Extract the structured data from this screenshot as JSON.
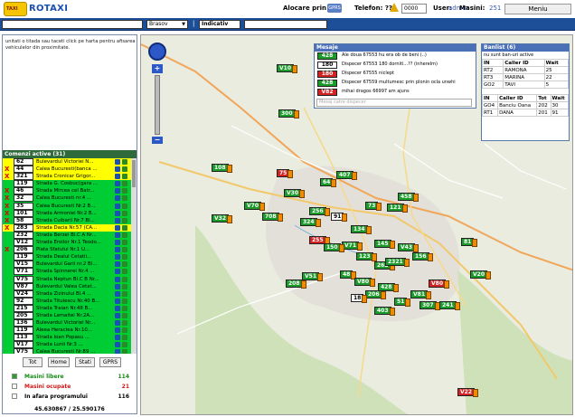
{
  "header": {
    "app_title": "ROTAXI",
    "alocare_label": "Alocare prin",
    "gprs_badge": "GPRS",
    "telefon_label": "Telefon: ???",
    "code_value": "0000",
    "user_label": "User:",
    "user_name": "admin",
    "masini_label": "Masini:",
    "masini_count": "251",
    "menu_button": "Meniu"
  },
  "toolbar": {
    "city": "Brasov",
    "separator": "|",
    "indicativ": "Indicativ"
  },
  "left": {
    "info_text": "unitati o titada sau taceti click pe harta pentru afisarea vehiculelor din proximitate.",
    "commands_header": "Comenzi active (31)",
    "rows": [
      {
        "x": "",
        "code": "62",
        "addr": "Bulevardul Victoriei N...",
        "bg": "#ffff00"
      },
      {
        "x": "X",
        "code": "44",
        "addr": "Calea Bucuresti(banca ...",
        "bg": "#ffff00"
      },
      {
        "x": "X",
        "code": "321",
        "addr": "Strada Cronicar Grigor...",
        "bg": "#ffff00"
      },
      {
        "x": "",
        "code": "119",
        "addr": "Strada G. Cosbuc(gara ...",
        "bg": "#00cc33"
      },
      {
        "x": "X",
        "code": "46",
        "addr": "Strada Mircea cel Batr...",
        "bg": "#00cc33"
      },
      {
        "x": "X",
        "code": "32",
        "addr": "Calea Bucuresti nr.4 ...",
        "bg": "#00cc33"
      },
      {
        "x": "X",
        "code": "35",
        "addr": "Calea Bucuresti Nr.2 B...",
        "bg": "#00cc33"
      },
      {
        "x": "X",
        "code": "101",
        "addr": "Strada Armoniei Nr.2 B...",
        "bg": "#00cc33"
      },
      {
        "x": "X",
        "code": "58",
        "addr": "Strada Cuibaril Nr.7 Bl...",
        "bg": "#00cc33"
      },
      {
        "x": "X",
        "code": "283",
        "addr": "Strada Dacia Nr.57 (CA...",
        "bg": "#ffff00"
      },
      {
        "x": "",
        "code": "232",
        "addr": "Strada Berzei Bl.C A Nr...",
        "bg": "#00cc33"
      },
      {
        "x": "",
        "code": "V12",
        "addr": "Strada Eroilor Nr.1 Teodo...",
        "bg": "#00cc33"
      },
      {
        "x": "X",
        "code": "206",
        "addr": "Piata Sfatului Nr.1 U...",
        "bg": "#00cc33"
      },
      {
        "x": "",
        "code": "119",
        "addr": "Strada Dealul Cetatii...",
        "bg": "#00cc33"
      },
      {
        "x": "",
        "code": "V15",
        "addr": "Bulevardul Garii nr.2 Bl...",
        "bg": "#00cc33"
      },
      {
        "x": "",
        "code": "V71",
        "addr": "Strada Spinnerei Nr.4 ...",
        "bg": "#00cc33"
      },
      {
        "x": "",
        "code": "V75",
        "addr": "Strada Neptun Bl.C B Nr...",
        "bg": "#00cc33"
      },
      {
        "x": "",
        "code": "V87",
        "addr": "Bulevardul Valea Cetat...",
        "bg": "#00cc33"
      },
      {
        "x": "",
        "code": "V24",
        "addr": "Strada Zizinului Bl.4 ...",
        "bg": "#00cc33"
      },
      {
        "x": "",
        "code": "92",
        "addr": "Strada Titulescu Nr.40 B...",
        "bg": "#00cc33"
      },
      {
        "x": "",
        "code": "215",
        "addr": "Strada Traian Nr.48 B...",
        "bg": "#00cc33"
      },
      {
        "x": "",
        "code": "205",
        "addr": "Strada Lamaitei Nr.2A...",
        "bg": "#00cc33"
      },
      {
        "x": "",
        "code": "136",
        "addr": "Bulevardul Victoriei Nr...",
        "bg": "#00cc33"
      },
      {
        "x": "",
        "code": "119",
        "addr": "Aleea Heraclea Nr.10...",
        "bg": "#00cc33"
      },
      {
        "x": "",
        "code": "113",
        "addr": "Strada Ioan Popasu ...",
        "bg": "#00cc33"
      },
      {
        "x": "",
        "code": "V17",
        "addr": "Strada Lunii Nr.3 ...",
        "bg": "#00cc33"
      },
      {
        "x": "",
        "code": "V75",
        "addr": "Calea Bucuresti Nr.89 ...",
        "bg": "#00cc33"
      }
    ],
    "buttons": {
      "tot": "Tot",
      "home": "Home",
      "stati": "Stati",
      "gprs": "GPRS"
    },
    "stats": [
      {
        "label": "Masini libere",
        "value": "114",
        "color": "#148a14"
      },
      {
        "label": "Masini ocupate",
        "value": "21",
        "color": "#d01515"
      },
      {
        "label": "In afara programului",
        "value": "116",
        "color": "#000000"
      }
    ],
    "coords": "45.630867 / 25.590176"
  },
  "messages": {
    "header": "Mesaje",
    "items": [
      {
        "code": "428",
        "text": "Ale doua  67553 hu era ob de beni (..)",
        "bg": "#1a9b2a",
        "fg": "#fff"
      },
      {
        "code": "180",
        "text": "Dispecer  67553 180 dorniti...?? (inherelm)",
        "bg": "#fff",
        "fg": "#000"
      },
      {
        "code": "180",
        "text": "Dispecer  67555 niclept",
        "bg": "#d22222",
        "fg": "#fff"
      },
      {
        "code": "428",
        "text": "Dispecer  67559 multumesc prin plonin ocla unwhi",
        "bg": "#1a9b2a",
        "fg": "#fff"
      },
      {
        "code": "V82",
        "text": "mihai dragos  66997 am ajuns",
        "bg": "#d22222",
        "fg": "#fff"
      }
    ],
    "input_placeholder": "Mesaj catre dispecer"
  },
  "drivers": {
    "header": "Banlist (6)",
    "sub": "nu sunt ban-uri active",
    "table1": {
      "headers": [
        "IN",
        "Caller ID",
        "Wait"
      ],
      "rows": [
        [
          "RT2",
          "RAMONA",
          "25"
        ],
        [
          "RT3",
          "MARINA",
          "22"
        ],
        [
          "GO2",
          "TAVI",
          "5"
        ]
      ]
    },
    "table2": {
      "headers": [
        "IN",
        "Caller ID",
        "Tot",
        "Wait"
      ],
      "rows": [
        [
          "GO4",
          "Banciu Oana",
          "202",
          "30"
        ],
        [
          "RT1",
          "DANA",
          "201",
          "91"
        ]
      ]
    }
  },
  "map": {
    "zoom_in": "+",
    "zoom_out": "−",
    "markers": [
      {
        "t": "V10",
        "s": "free"
      },
      {
        "t": "300",
        "s": "free"
      },
      {
        "t": "108",
        "s": "free"
      },
      {
        "t": "75",
        "s": "busy"
      },
      {
        "t": "V32",
        "s": "free"
      },
      {
        "t": "V70",
        "s": "free"
      },
      {
        "t": "708",
        "s": "free"
      },
      {
        "t": "V30",
        "s": "free"
      },
      {
        "t": "407",
        "s": "free"
      },
      {
        "t": "64",
        "s": "free"
      },
      {
        "t": "458",
        "s": "free"
      },
      {
        "t": "121",
        "s": "free"
      },
      {
        "t": "324",
        "s": "free"
      },
      {
        "t": "256",
        "s": "free"
      },
      {
        "t": "91",
        "s": "other"
      },
      {
        "t": "73",
        "s": "free"
      },
      {
        "t": "255",
        "s": "busy"
      },
      {
        "t": "134",
        "s": "free"
      },
      {
        "t": "145",
        "s": "free"
      },
      {
        "t": "V43",
        "s": "free"
      },
      {
        "t": "81",
        "s": "free"
      },
      {
        "t": "V51",
        "s": "free"
      },
      {
        "t": "48",
        "s": "free"
      },
      {
        "t": "206",
        "s": "free"
      },
      {
        "t": "262",
        "s": "free"
      },
      {
        "t": "V20",
        "s": "free"
      },
      {
        "t": "208",
        "s": "free"
      },
      {
        "t": "V80",
        "s": "free"
      },
      {
        "t": "18",
        "s": "other"
      },
      {
        "t": "428",
        "s": "free"
      },
      {
        "t": "51",
        "s": "free"
      },
      {
        "t": "307",
        "s": "free"
      },
      {
        "t": "156",
        "s": "free"
      },
      {
        "t": "V81",
        "s": "free"
      },
      {
        "t": "V71",
        "s": "free"
      },
      {
        "t": "2321",
        "s": "free"
      },
      {
        "t": "150",
        "s": "free"
      },
      {
        "t": "123",
        "s": "free"
      },
      {
        "t": "403",
        "s": "free"
      },
      {
        "t": "V80",
        "s": "busy"
      },
      {
        "t": "241",
        "s": "free"
      },
      {
        "t": "V22",
        "s": "busy"
      }
    ]
  }
}
